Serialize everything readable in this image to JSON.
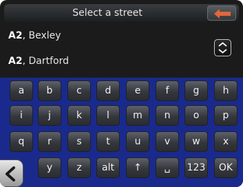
{
  "header": {
    "title": "Select a street",
    "back_icon": "orange-left-arrow-icon",
    "accent_color": "#e0673a"
  },
  "results": [
    {
      "road": "A2",
      "place": ", Bexley"
    },
    {
      "road": "A2",
      "place": ", Dartford"
    }
  ],
  "scroll_icon": "up-down-chevron-icon",
  "keyboard": {
    "rows": [
      [
        "a",
        "b",
        "c",
        "d",
        "e",
        "f",
        "g",
        "h"
      ],
      [
        "i",
        "j",
        "k",
        "l",
        "m",
        "n",
        "o",
        "p"
      ],
      [
        "q",
        "r",
        "s",
        "t",
        "u",
        "v",
        "w",
        "x"
      ],
      [
        "y",
        "z",
        "alt",
        "↑",
        "␣",
        "123",
        "OK"
      ]
    ],
    "background_color": "#1a2a8c"
  },
  "nav_back_icon": "chevron-left-icon"
}
